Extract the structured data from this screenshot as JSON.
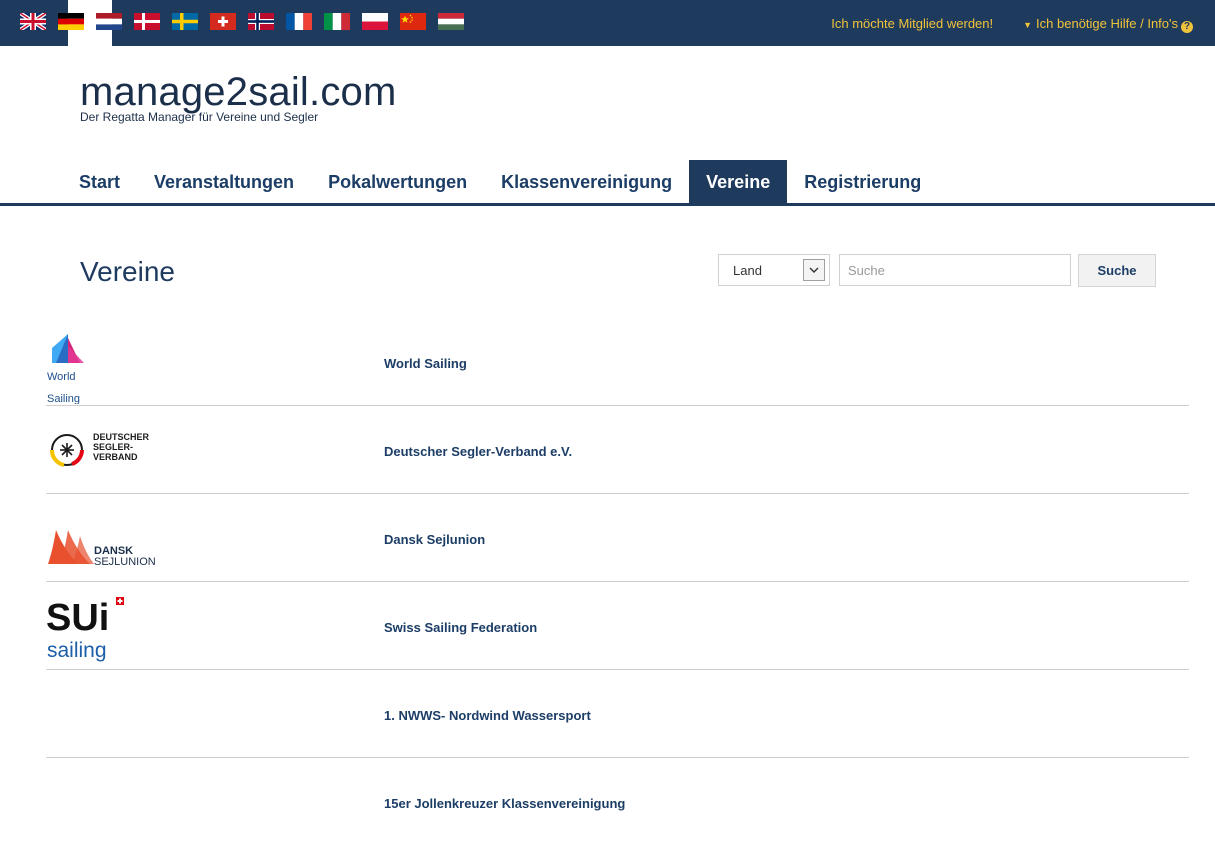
{
  "topbar": {
    "flags": [
      {
        "code": "uk"
      },
      {
        "code": "de",
        "active": true
      },
      {
        "code": "nl"
      },
      {
        "code": "dk"
      },
      {
        "code": "se"
      },
      {
        "code": "ch"
      },
      {
        "code": "no"
      },
      {
        "code": "fr"
      },
      {
        "code": "it"
      },
      {
        "code": "pl"
      },
      {
        "code": "cn"
      },
      {
        "code": "hu"
      }
    ],
    "member_link": "Ich möchte Mitglied werden!",
    "help_link": "Ich benötige Hilfe / Info's"
  },
  "brand": {
    "title": "manage2sail.com",
    "subtitle": "Der Regatta Manager für Vereine und Segler"
  },
  "nav": {
    "items": [
      "Start",
      "Veranstaltungen",
      "Pokalwertungen",
      "Klassenvereinigung",
      "Vereine",
      "Registrierung"
    ],
    "active": "Vereine"
  },
  "page": {
    "title": "Vereine",
    "country_select": "Land",
    "search_placeholder": "Suche",
    "search_button": "Suche"
  },
  "clubs": [
    {
      "name": "World Sailing",
      "logo": "world-sailing",
      "logo_text": [
        "World",
        "Sailing"
      ]
    },
    {
      "name": "Deutscher Segler-Verband e.V.",
      "logo": "dsv",
      "logo_text": [
        "DEUTSCHER",
        "SEGLER-",
        "VERBAND"
      ]
    },
    {
      "name": "Dansk Sejlunion",
      "logo": "dansk",
      "logo_text": [
        "DANSK",
        "SEJLUNION"
      ]
    },
    {
      "name": "Swiss Sailing Federation",
      "logo": "sui",
      "logo_text": [
        "SUi",
        "sailing"
      ]
    },
    {
      "name": "1. NWWS- Nordwind Wassersport",
      "logo": null
    },
    {
      "name": "15er Jollenkreuzer Klassenvereinigung",
      "logo": null
    }
  ],
  "colors": {
    "navy": "#1e3a5c",
    "accent_yellow": "#f0c33c",
    "link_blue": "#1c3d66"
  }
}
